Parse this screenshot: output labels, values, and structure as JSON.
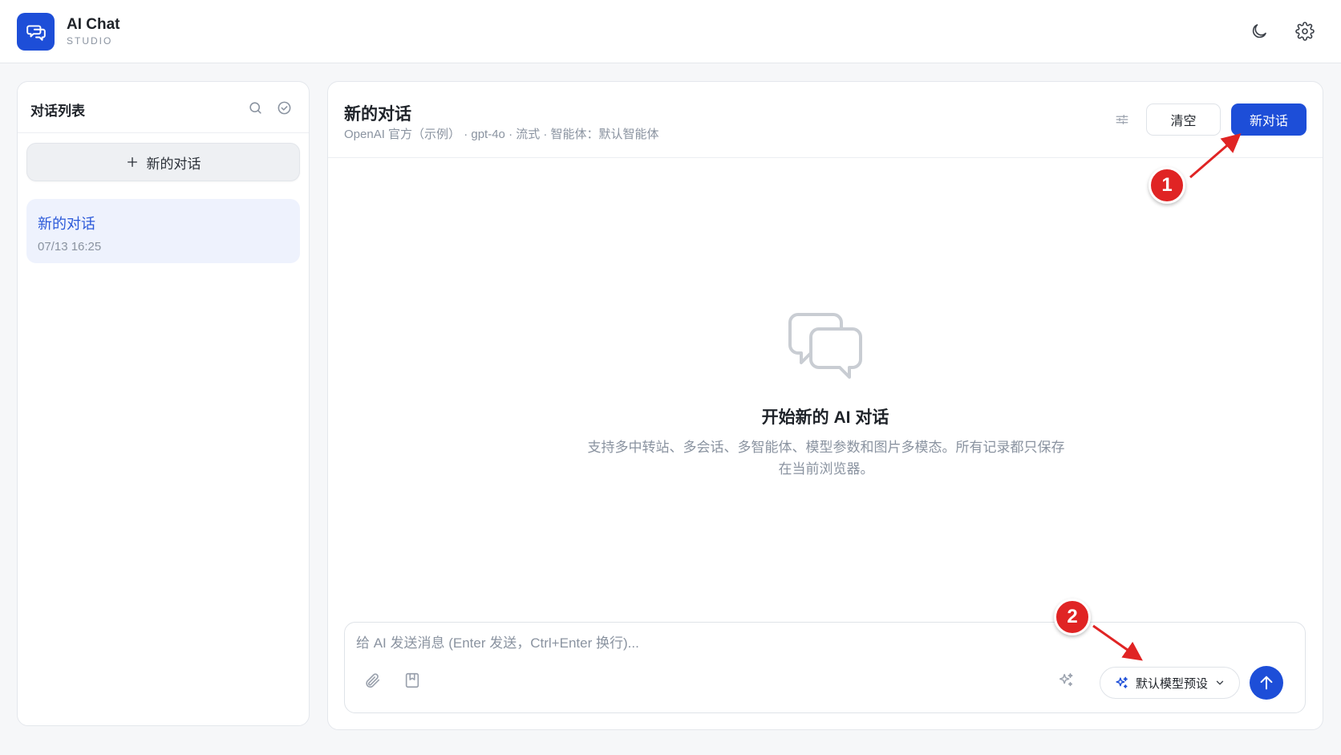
{
  "app": {
    "brand_name": "AI Chat",
    "brand_sub": "STUDIO",
    "icons": {
      "logo": "chat-bubbles-icon",
      "theme": "moon-icon",
      "settings": "gear-icon"
    }
  },
  "sidebar": {
    "title": "对话列表",
    "search_icon": "search-icon",
    "select_icon": "check-circle-icon",
    "new_chat_label": "新的对话",
    "conversations": [
      {
        "title": "新的对话",
        "time": "07/13 16:25",
        "active": true
      }
    ]
  },
  "chat": {
    "title": "新的对话",
    "subtitle": "OpenAI 官方（示例） · gpt-4o · 流式 · 智能体：默认智能体",
    "clear_label": "清空",
    "new_label": "新对话",
    "empty_title": "开始新的 AI 对话",
    "empty_desc": "支持多中转站、多会话、多智能体、模型参数和图片多模态。所有记录都只保存在当前浏览器。"
  },
  "composer": {
    "placeholder": "给 AI 发送消息 (Enter 发送，Ctrl+Enter 换行)...",
    "preset_label": "默认模型预设",
    "icons": {
      "attach": "paperclip-icon",
      "bookmark": "bookmark-icon",
      "magic": "sparkle-icon",
      "send": "arrow-up-icon"
    }
  },
  "annotations": [
    {
      "label": "1"
    },
    {
      "label": "2"
    }
  ],
  "colors": {
    "accent": "#1d4ed8",
    "marker": "#e02424",
    "muted": "#8a93a0"
  }
}
